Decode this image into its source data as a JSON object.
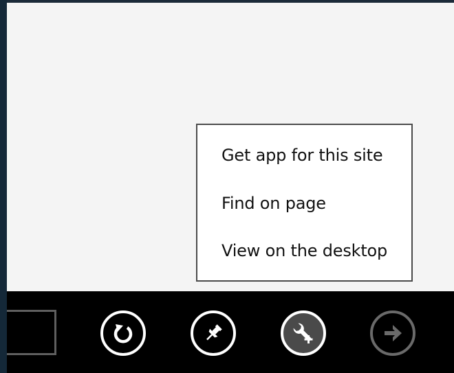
{
  "page_menu": {
    "items": [
      {
        "label": "Get app for this site"
      },
      {
        "label": "Find on page"
      },
      {
        "label": "View on the desktop"
      }
    ]
  },
  "app_bar": {
    "buttons": [
      {
        "icon": "refresh-icon"
      },
      {
        "icon": "pin-icon"
      },
      {
        "icon": "page-tools-icon"
      },
      {
        "icon": "forward-arrow-icon",
        "disabled": true
      }
    ]
  },
  "colors": {
    "app_bar_bg": "#000000",
    "page_bg": "#f4f4f4",
    "frame_bg": "#1c2c3a",
    "disabled_icon": "#6a6a6a"
  }
}
